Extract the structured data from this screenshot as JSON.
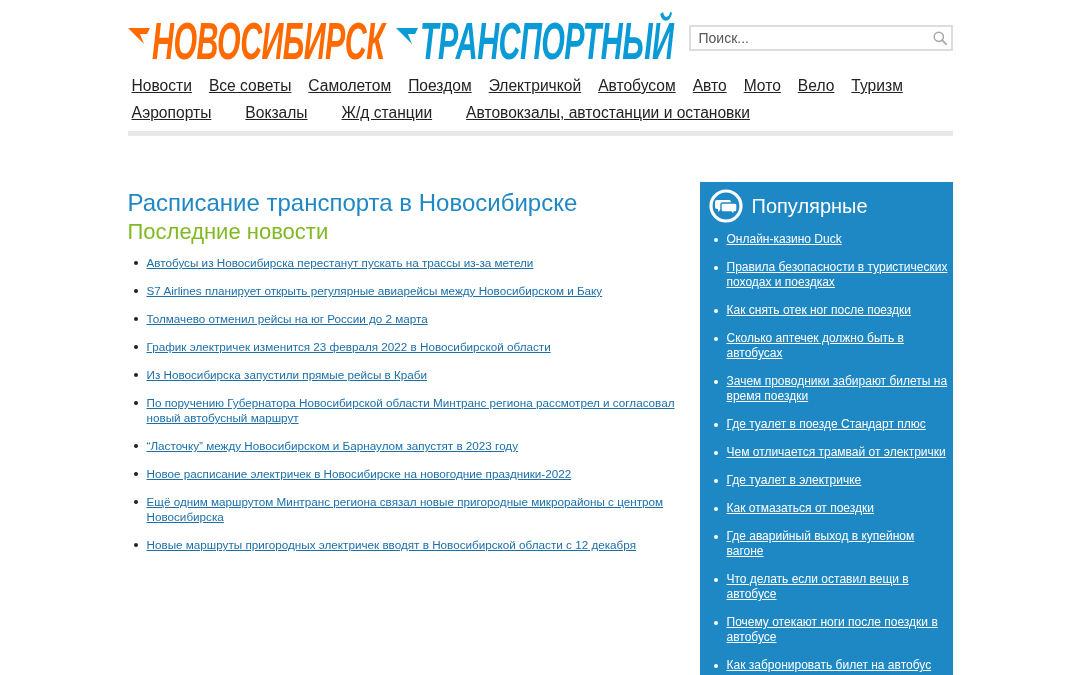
{
  "logo": {
    "words": [
      {
        "text": "НОВОСИБИРСК",
        "color": "#ff6a00"
      },
      {
        "text": "ТРАНСПОРТНЫЙ",
        "color": "#0a9bd6"
      }
    ]
  },
  "search": {
    "placeholder": "Поиск..."
  },
  "main_menu": [
    "Новости",
    "Все советы",
    "Самолетом",
    "Поездом",
    "Электричкой",
    "Автобусом",
    "Авто",
    "Мото",
    "Вело",
    "Туризм"
  ],
  "section_menu": [
    "Аэропорты",
    "Вокзалы",
    "Ж/д станции",
    "Автовокзалы, автостанции и остановки"
  ],
  "content": {
    "title": "Расписание транспорта в Новосибирске",
    "subtitle": "Последние новости",
    "news": [
      "Автобусы из Новосибирска перестанут пускать на трассы из-за метели",
      "S7 Airlines планирует открыть регулярные авиарейсы между Новосибирском и Баку",
      "Толмачево отменил рейсы на юг России до 2 марта",
      "График электричек изменится 23 февраля 2022 в Новосибирской области",
      "Из Новосибирска запустили прямые рейсы в Краби",
      "По поручению Губернатора Новосибирской области Минтранс региона рассмотрел и согласовал новый автобусный маршрут",
      "“Ласточку” между Новосибирском и Барнаулом запустят в 2023 году",
      "Новое расписание электричек в Новосибирске на новогодние праздники-2022",
      "Ещё одним маршрутом Минтранс региона связал новые пригородные микрорайоны с центром Новосибирска",
      "Новые маршруты пригородных электричек вводят в Новосибирской области с 12 декабря"
    ]
  },
  "sidebar": {
    "title": "Популярные",
    "items": [
      "Онлайн-казино Duck",
      "Правила безопасности в туристических походах и поездках",
      "Как снять отек ног после поездки",
      "Сколько аптечек должно быть в автобусах",
      "Зачем проводники забирают билеты на время поездки",
      "Где туалет в поезде Стандарт плюс",
      "Чем отличается трамвай от электрички",
      "Где туалет в электричке",
      "Как отмазаться от поездки",
      "Где аварийный выход в купейном вагоне",
      "Что делать если оставил вещи в автобусе",
      "Почему отекают ноги после поездки в автобусе",
      "Как забронировать билет на автобус"
    ]
  }
}
